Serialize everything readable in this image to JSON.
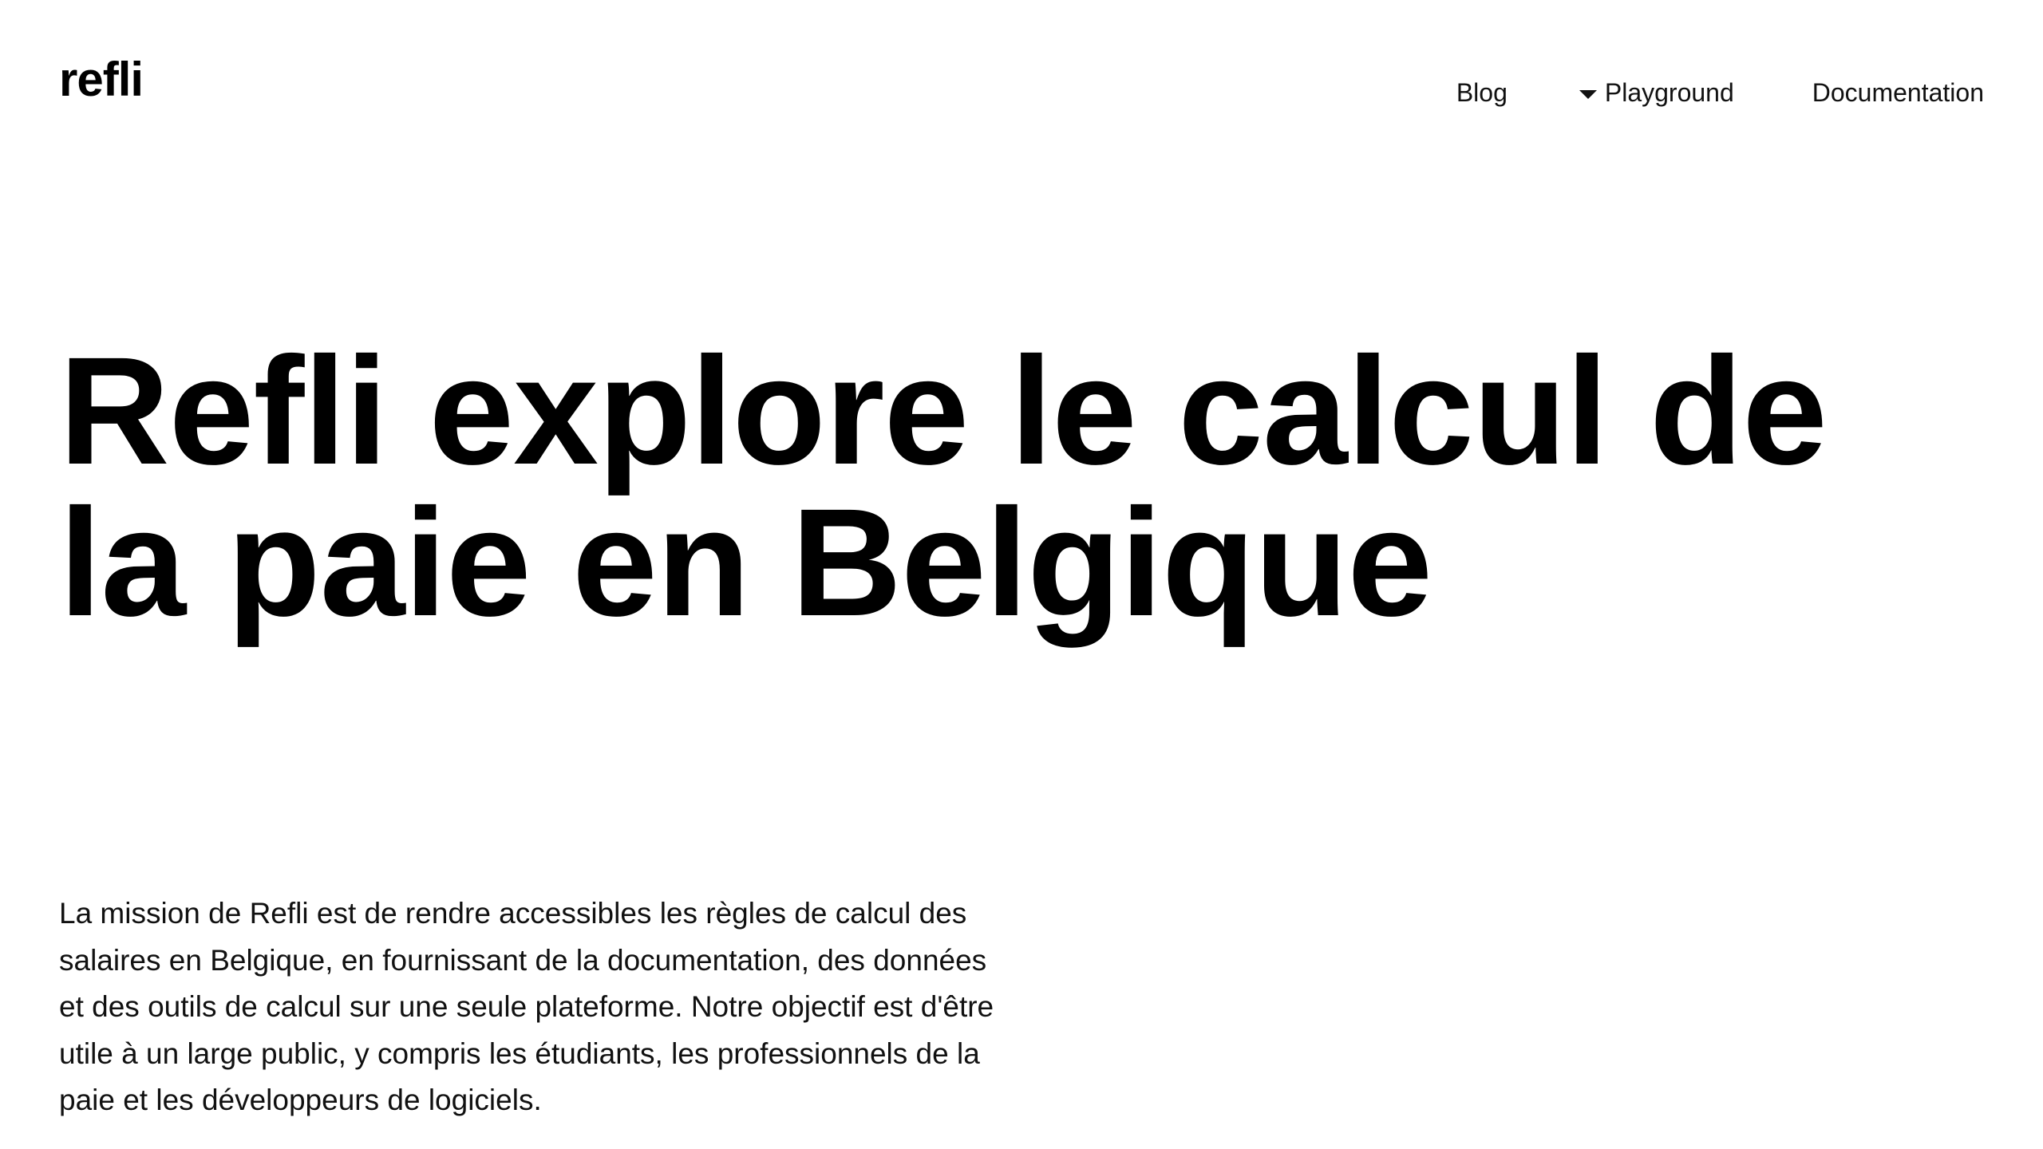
{
  "header": {
    "logo": "refli",
    "nav": {
      "blog": "Blog",
      "playground": "Playground",
      "documentation": "Documentation"
    }
  },
  "hero": {
    "title": "Refli explore le calcul de la paie en Belgique"
  },
  "mission": {
    "text": "La mission de Refli est de rendre accessibles les règles de calcul des salaires en Belgique, en fournissant de la documentation, des données et des outils de calcul sur une seule plateforme. Notre objectif est d'être utile à un large public, y compris les étudiants, les professionnels de la paie et les développeurs de logiciels."
  },
  "icons": {
    "playground_dropdown": "caret-down-icon"
  },
  "colors": {
    "background": "#ffffff",
    "text": "#000000"
  }
}
